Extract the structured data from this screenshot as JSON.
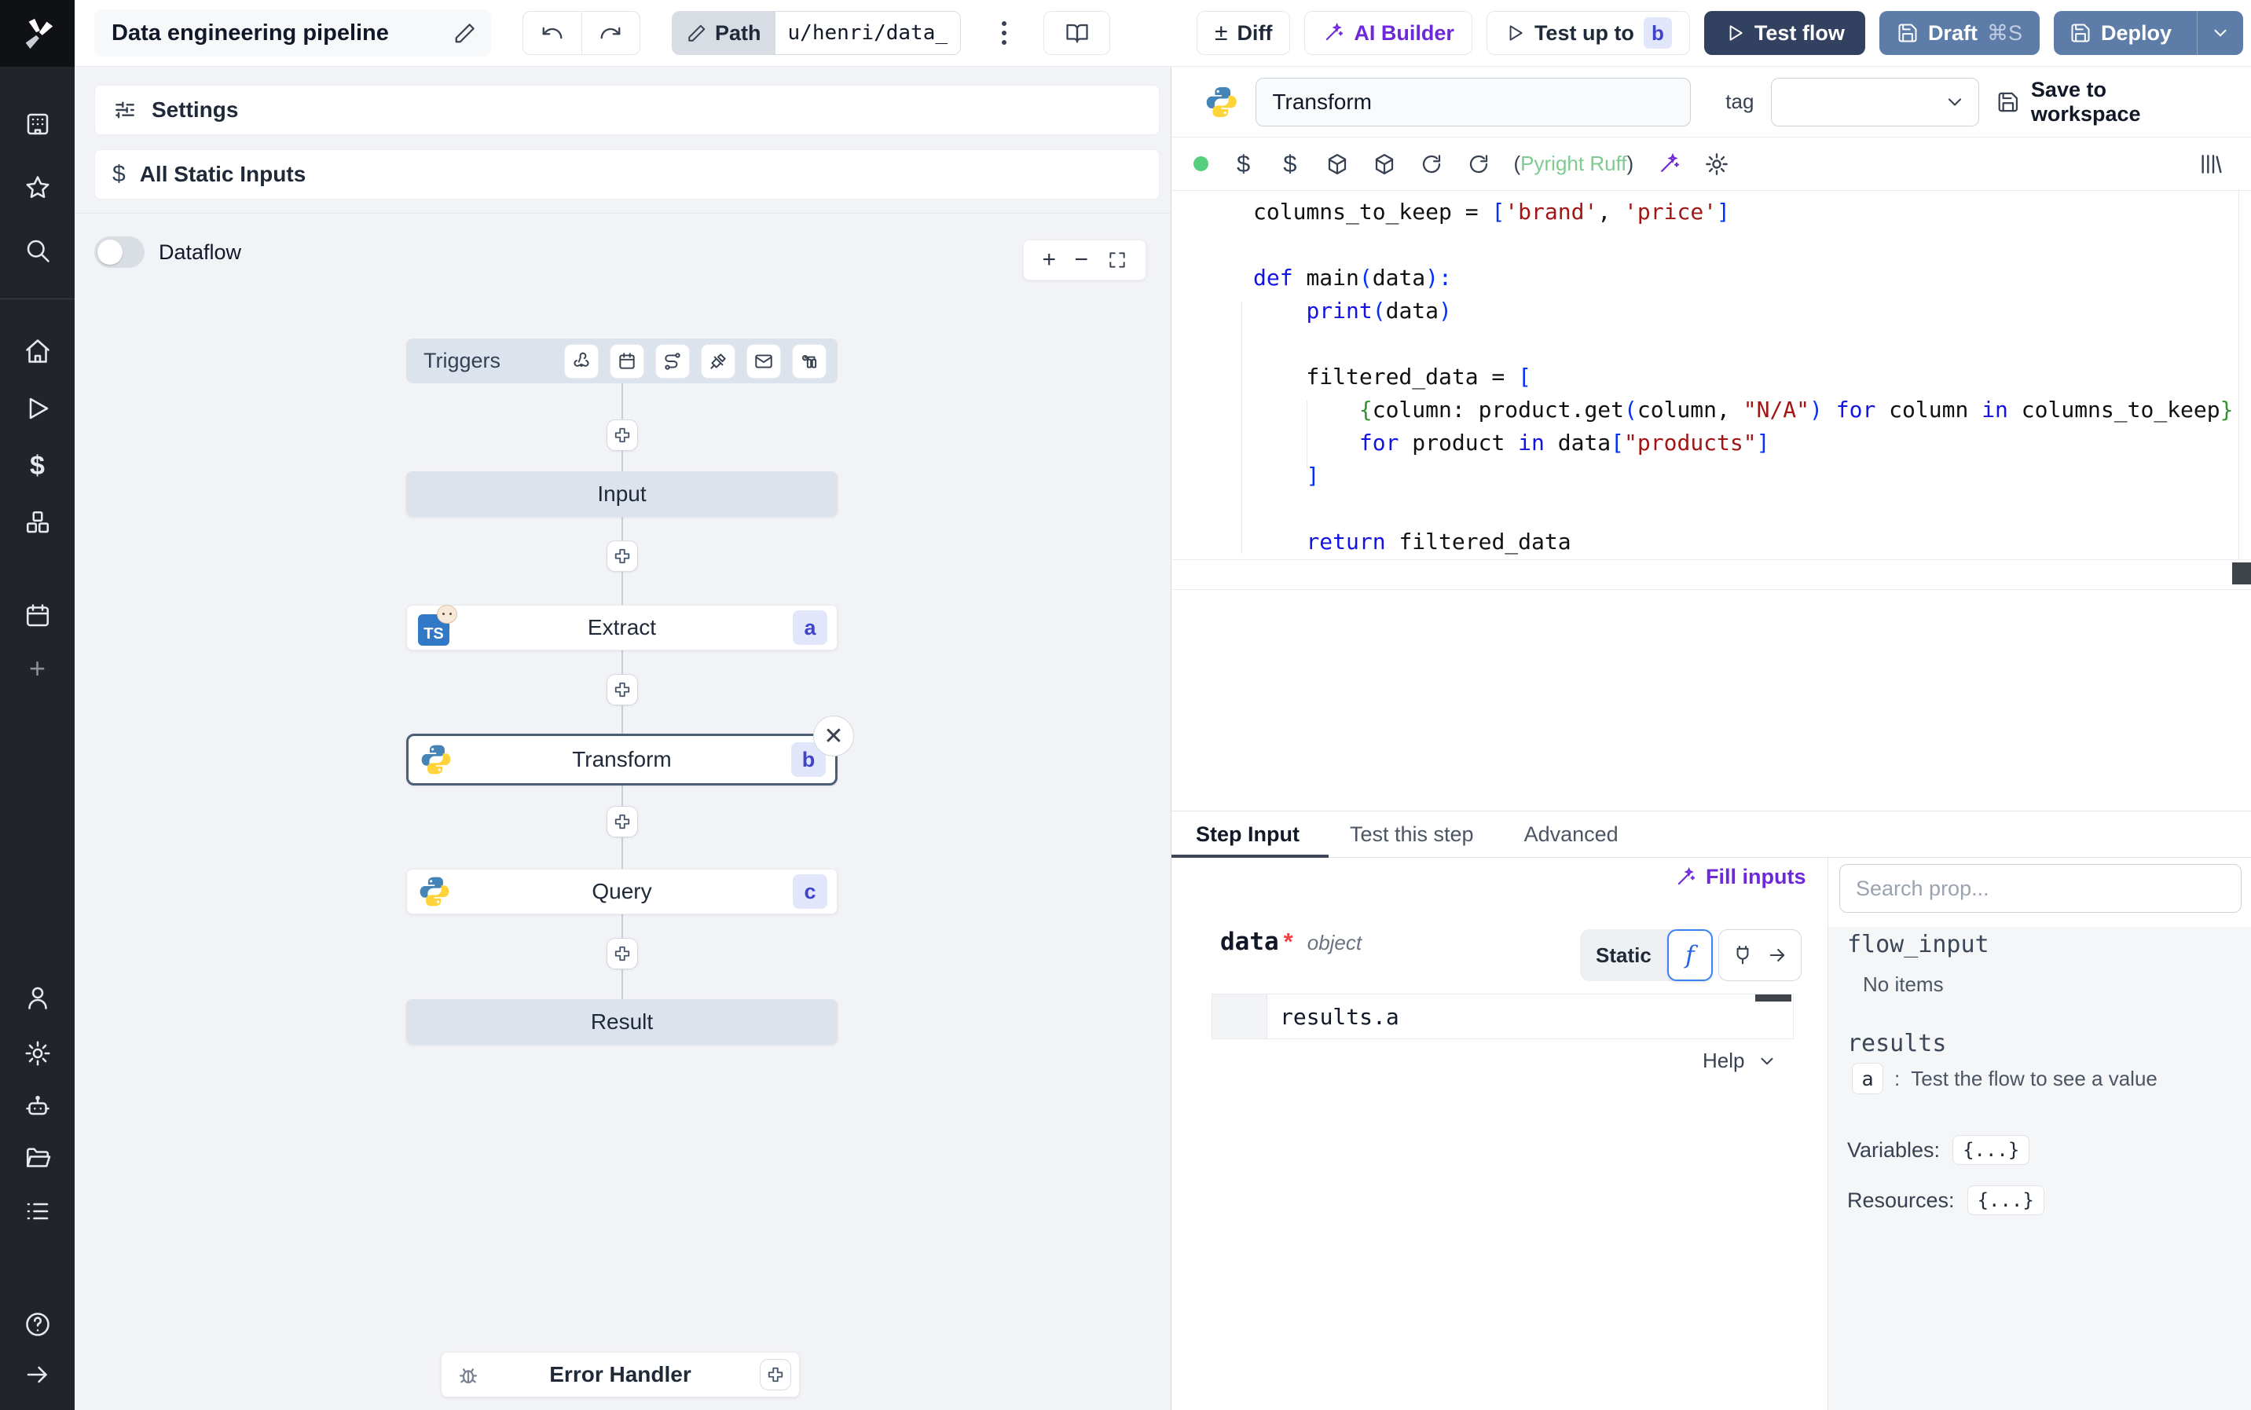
{
  "topbar": {
    "title": "Data engineering pipeline",
    "path_label": "Path",
    "path_value": "u/henri/data_",
    "diff_label": "Diff",
    "ai_builder_label": "AI Builder",
    "test_up_to_label": "Test up to",
    "test_up_to_badge": "b",
    "test_flow_label": "Test flow",
    "draft_label": "Draft",
    "draft_shortcut": "⌘S",
    "deploy_label": "Deploy"
  },
  "canvas": {
    "settings_label": "Settings",
    "static_inputs_label": "All Static Inputs",
    "dataflow_label": "Dataflow",
    "triggers_label": "Triggers",
    "nodes": {
      "input_label": "Input",
      "extract_label": "Extract",
      "extract_badge": "a",
      "extract_lang": "TS",
      "transform_label": "Transform",
      "transform_badge": "b",
      "query_label": "Query",
      "query_badge": "c",
      "result_label": "Result"
    },
    "error_handler_label": "Error Handler"
  },
  "editor": {
    "step_name": "Transform",
    "tag_label": "tag",
    "save_label": "Save to workspace",
    "lint_open": "(",
    "lint_text": "Pyright Ruff",
    "lint_close": ")",
    "code": [
      [
        [
          "columns_to_keep = ",
          "p"
        ],
        [
          "[",
          "b"
        ],
        [
          "'brand'",
          "s"
        ],
        [
          ", ",
          "p"
        ],
        [
          "'price'",
          "s"
        ],
        [
          "]",
          "b"
        ]
      ],
      [],
      [
        [
          "def ",
          "k"
        ],
        [
          "main",
          "p"
        ],
        [
          "(",
          "b"
        ],
        [
          "data",
          "p"
        ],
        [
          "):",
          "b"
        ]
      ],
      [
        [
          "    ",
          "p"
        ],
        [
          "print",
          "k"
        ],
        [
          "(",
          "b"
        ],
        [
          "data",
          "p"
        ],
        [
          ")",
          "b"
        ]
      ],
      [],
      [
        [
          "    filtered_data = ",
          "p"
        ],
        [
          "[",
          "b"
        ]
      ],
      [
        [
          "        ",
          "p"
        ],
        [
          "{",
          "g"
        ],
        [
          "column: product.get",
          "p"
        ],
        [
          "(",
          "b"
        ],
        [
          "column, ",
          "p"
        ],
        [
          "\"N/A\"",
          "s"
        ],
        [
          ")",
          "b"
        ],
        [
          " ",
          "p"
        ],
        [
          "for",
          "k"
        ],
        [
          " column ",
          "p"
        ],
        [
          "in",
          "k"
        ],
        [
          " columns_to_keep",
          "p"
        ],
        [
          "}",
          "g"
        ]
      ],
      [
        [
          "        ",
          "p"
        ],
        [
          "for",
          "k"
        ],
        [
          " product ",
          "p"
        ],
        [
          "in",
          "k"
        ],
        [
          " data",
          "p"
        ],
        [
          "[",
          "b"
        ],
        [
          "\"products\"",
          "s"
        ],
        [
          "]",
          "b"
        ]
      ],
      [
        [
          "    ",
          "p"
        ],
        [
          "]",
          "b"
        ]
      ],
      [],
      [
        [
          "    ",
          "p"
        ],
        [
          "return",
          "k"
        ],
        [
          " filtered_data",
          "p"
        ]
      ]
    ]
  },
  "tabs": {
    "step_input": "Step Input",
    "test_step": "Test this step",
    "advanced": "Advanced"
  },
  "step_input": {
    "fill_inputs_label": "Fill inputs",
    "field_name": "data",
    "required_mark": "*",
    "field_type": "object",
    "static_label": "Static",
    "fn_label": "f",
    "expr_value": "results.a",
    "help_label": "Help"
  },
  "props": {
    "search_placeholder": "Search prop...",
    "flow_input_label": "flow_input",
    "no_items_label": "No items",
    "results_label": "results",
    "result_key": "a",
    "result_separator": ":",
    "result_hint": "Test the flow to see a value",
    "variables_label": "Variables:",
    "variables_badge": "{...}",
    "resources_label": "Resources:",
    "resources_badge": "{...}"
  },
  "colors": {
    "accent_purple": "#6d28d9",
    "badge_bg": "#e1e6fb",
    "badge_text": "#4044c9",
    "test_flow_navy": "#31415f",
    "deploy_slate": "#5d7ca8",
    "lint_green": "#7fca8f",
    "status_green": "#55ce7e",
    "selected_border": "#4c5d76",
    "canvas_bg": "#f2f3f6",
    "node_plain_bg": "#dce3ed"
  }
}
